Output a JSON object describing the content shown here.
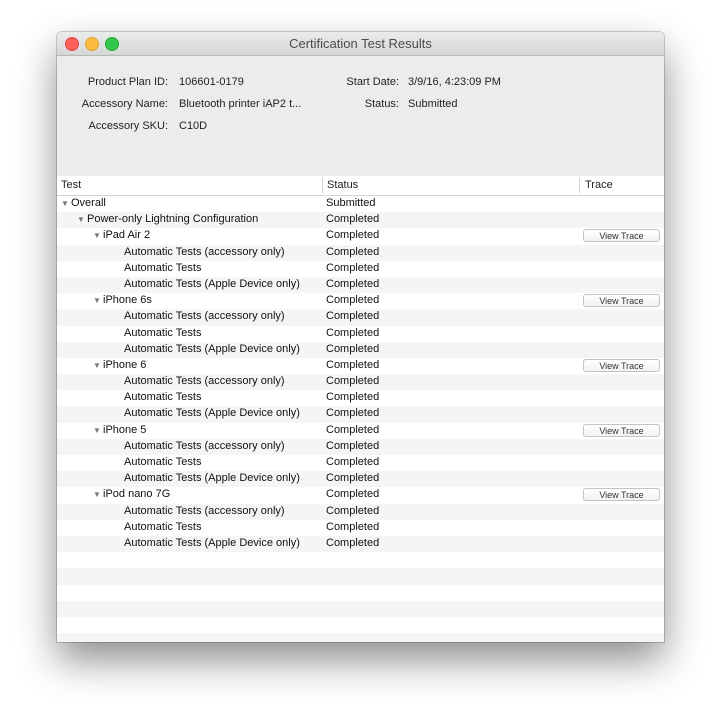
{
  "window": {
    "title": "Certification Test Results"
  },
  "info": {
    "product_plan_label": "Product Plan ID:",
    "product_plan_value": "106601-0179",
    "accessory_name_label": "Accessory Name:",
    "accessory_name_value": "Bluetooth printer iAP2 t...",
    "accessory_sku_label": "Accessory SKU:",
    "accessory_sku_value": "C10D",
    "start_date_label": "Start Date:",
    "start_date_value": "3/9/16, 4:23:09 PM",
    "status_label": "Status:",
    "status_value": "Submitted"
  },
  "table": {
    "headers": {
      "test": "Test",
      "status": "Status",
      "trace": "Trace"
    },
    "trace_button_label": "View Trace",
    "rows": [
      {
        "test": "Overall",
        "status": "Submitted",
        "indent": 0,
        "disclosure": true,
        "trace": false
      },
      {
        "test": "Power-only Lightning Configuration",
        "status": "Completed",
        "indent": 1,
        "disclosure": true,
        "trace": false
      },
      {
        "test": "iPad Air 2",
        "status": "Completed",
        "indent": 2,
        "disclosure": true,
        "trace": true
      },
      {
        "test": "Automatic Tests (accessory only)",
        "status": "Completed",
        "indent": 3,
        "disclosure": false,
        "trace": false
      },
      {
        "test": "Automatic Tests",
        "status": "Completed",
        "indent": 3,
        "disclosure": false,
        "trace": false
      },
      {
        "test": "Automatic Tests (Apple Device only)",
        "status": "Completed",
        "indent": 3,
        "disclosure": false,
        "trace": false
      },
      {
        "test": "iPhone 6s",
        "status": "Completed",
        "indent": 2,
        "disclosure": true,
        "trace": true
      },
      {
        "test": "Automatic Tests (accessory only)",
        "status": "Completed",
        "indent": 3,
        "disclosure": false,
        "trace": false
      },
      {
        "test": "Automatic Tests",
        "status": "Completed",
        "indent": 3,
        "disclosure": false,
        "trace": false
      },
      {
        "test": "Automatic Tests (Apple Device only)",
        "status": "Completed",
        "indent": 3,
        "disclosure": false,
        "trace": false
      },
      {
        "test": "iPhone 6",
        "status": "Completed",
        "indent": 2,
        "disclosure": true,
        "trace": true
      },
      {
        "test": "Automatic Tests (accessory only)",
        "status": "Completed",
        "indent": 3,
        "disclosure": false,
        "trace": false
      },
      {
        "test": "Automatic Tests",
        "status": "Completed",
        "indent": 3,
        "disclosure": false,
        "trace": false
      },
      {
        "test": "Automatic Tests (Apple Device only)",
        "status": "Completed",
        "indent": 3,
        "disclosure": false,
        "trace": false
      },
      {
        "test": "iPhone 5",
        "status": "Completed",
        "indent": 2,
        "disclosure": true,
        "trace": true
      },
      {
        "test": "Automatic Tests (accessory only)",
        "status": "Completed",
        "indent": 3,
        "disclosure": false,
        "trace": false
      },
      {
        "test": "Automatic Tests",
        "status": "Completed",
        "indent": 3,
        "disclosure": false,
        "trace": false
      },
      {
        "test": "Automatic Tests (Apple Device only)",
        "status": "Completed",
        "indent": 3,
        "disclosure": false,
        "trace": false
      },
      {
        "test": "iPod nano 7G",
        "status": "Completed",
        "indent": 2,
        "disclosure": true,
        "trace": true
      },
      {
        "test": "Automatic Tests (accessory only)",
        "status": "Completed",
        "indent": 3,
        "disclosure": false,
        "trace": false
      },
      {
        "test": "Automatic Tests",
        "status": "Completed",
        "indent": 3,
        "disclosure": false,
        "trace": false
      },
      {
        "test": "Automatic Tests (Apple Device only)",
        "status": "Completed",
        "indent": 3,
        "disclosure": false,
        "trace": false
      }
    ]
  },
  "icons": {
    "close": "close-icon",
    "minimize": "minimize-icon",
    "maximize": "maximize-icon",
    "disclosure": "disclosure-triangle-icon",
    "disclosure_glyph": "▼"
  },
  "colors": {
    "close": "#fc605b",
    "minimize": "#fdbc40",
    "maximize": "#34c84a",
    "row_stripe": "#f4f5f5"
  }
}
